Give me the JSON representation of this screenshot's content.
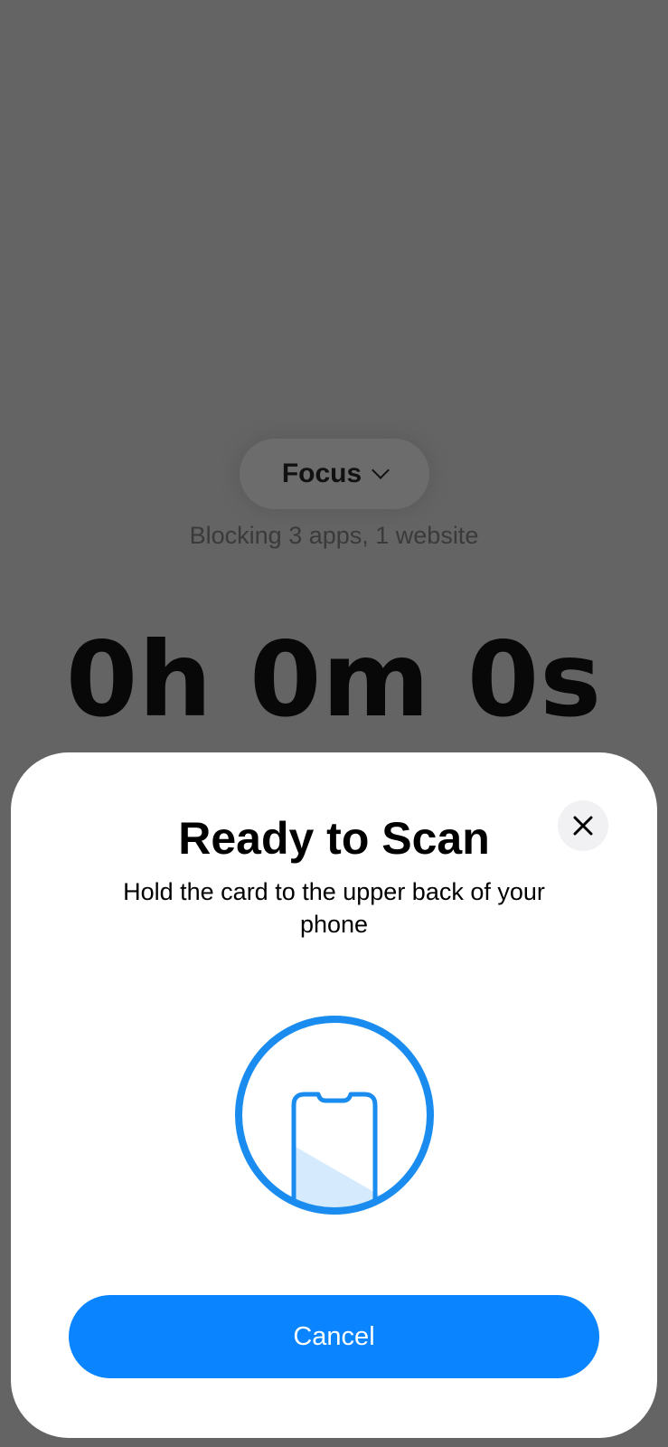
{
  "background": {
    "focus_label": "Focus",
    "focus_icon": "chevron-down-icon",
    "blocking_text": "Blocking 3 apps, 1 website",
    "timer": "0h 0m 0s"
  },
  "scan_sheet": {
    "title": "Ready to Scan",
    "subtitle": "Hold the card to the upper back of your phone",
    "close_icon": "close-icon",
    "illustration_icon": "phone-nfc-scan-icon",
    "cancel_label": "Cancel"
  },
  "colors": {
    "accent": "#0a84ff",
    "dim_background": "#646464",
    "sheet": "#ffffff"
  }
}
